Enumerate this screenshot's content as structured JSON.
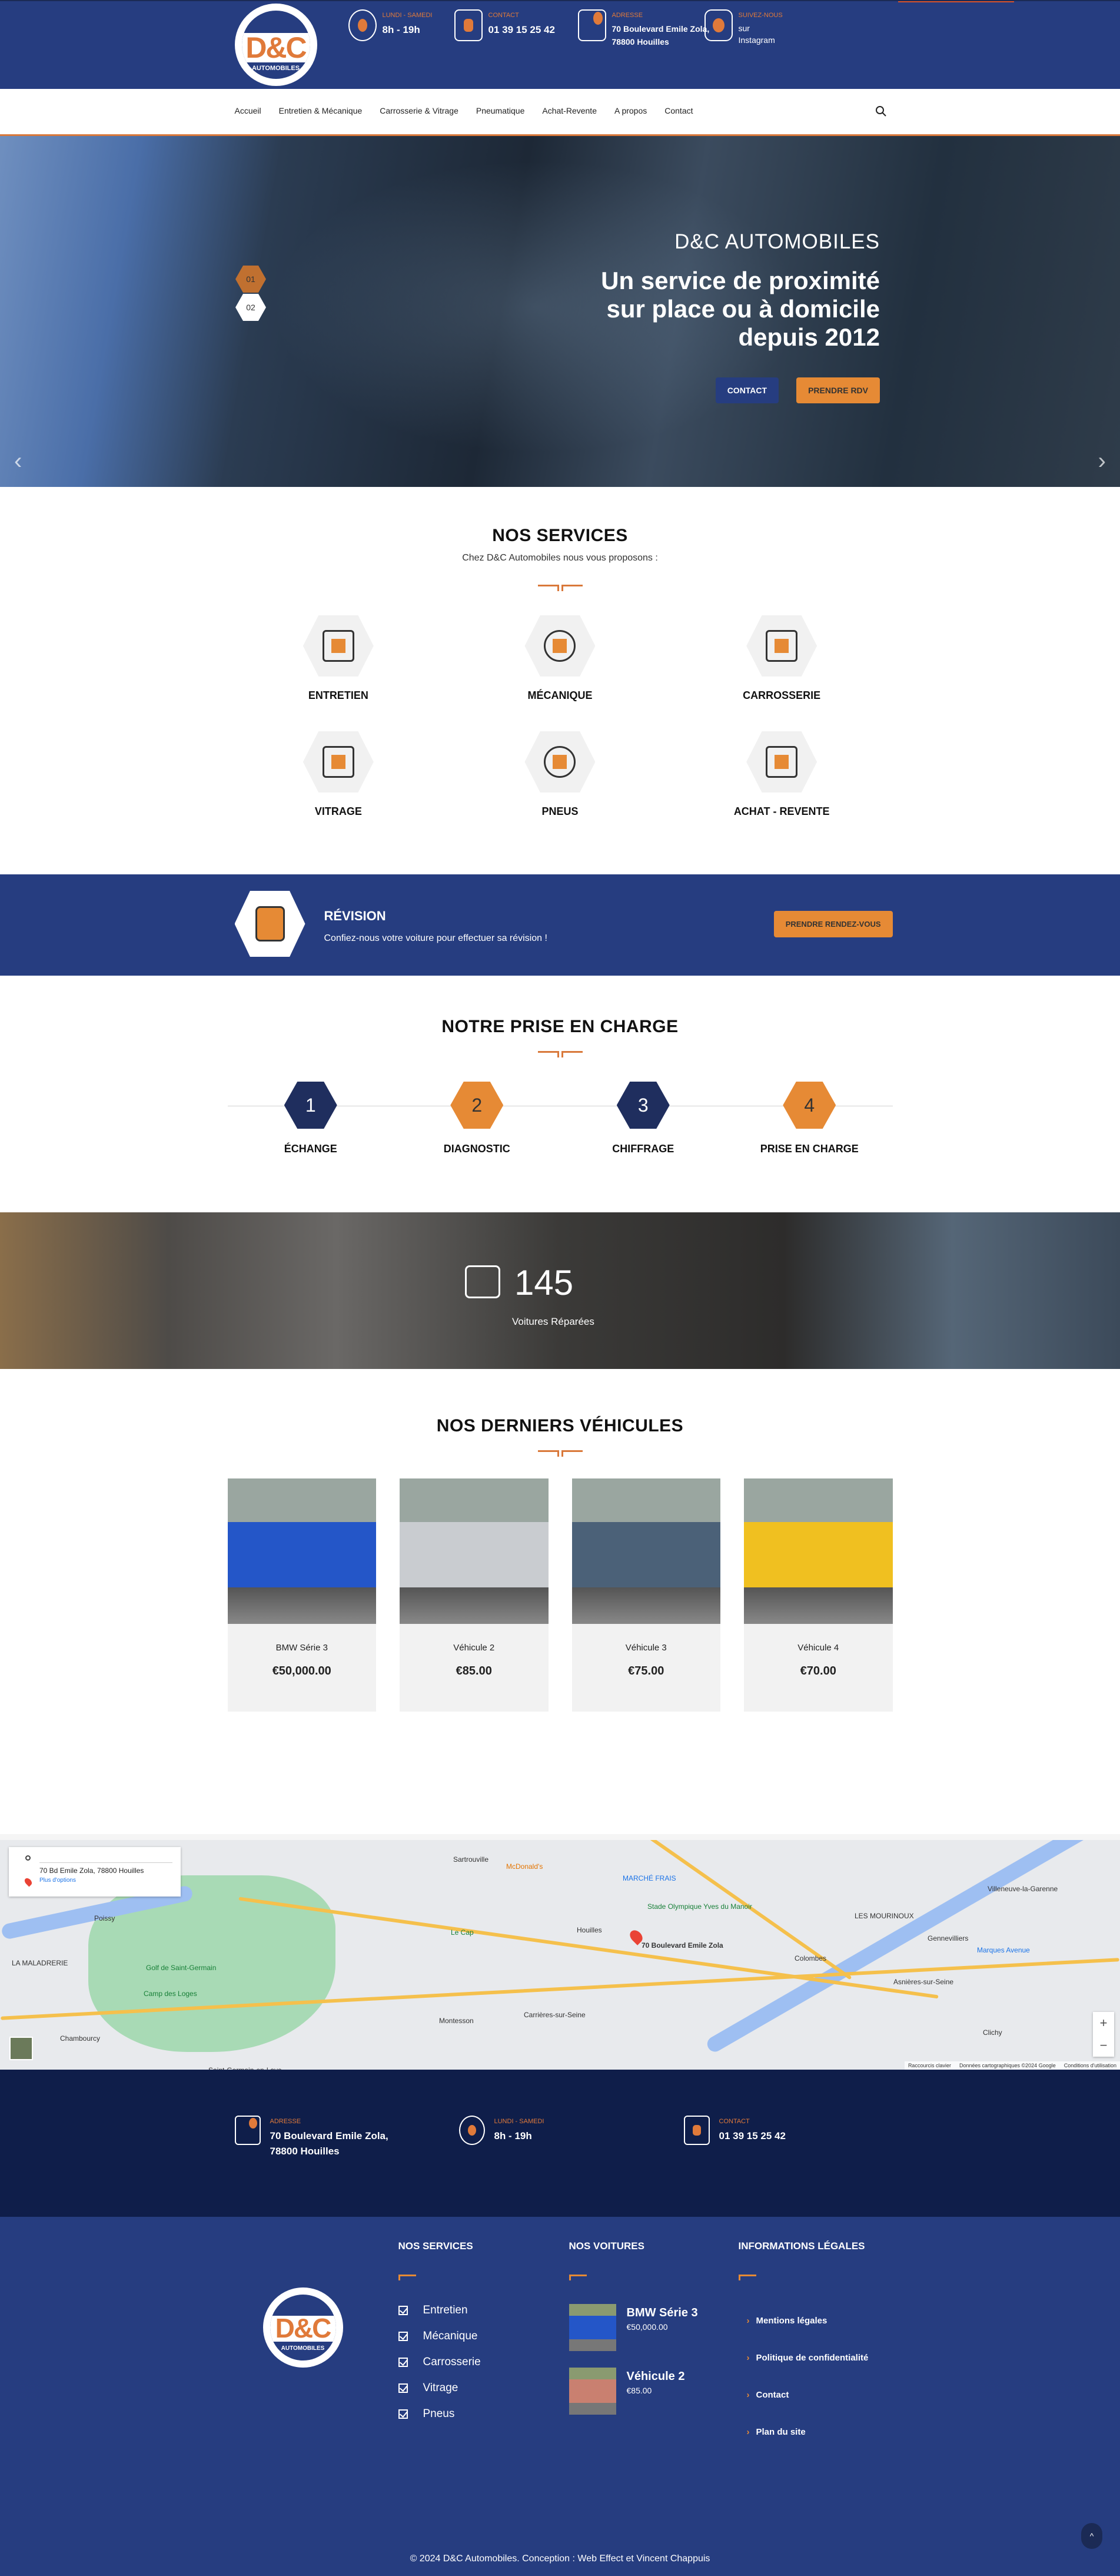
{
  "brand": {
    "logo_main": "D&C",
    "logo_sub": "AUTOMOBILES"
  },
  "topbar": {
    "hours": {
      "label": "LUNDI - SAMEDI",
      "value": "8h - 19h"
    },
    "contact": {
      "label": "CONTACT",
      "value": "01 39 15 25 42"
    },
    "address": {
      "label": "ADRESSE",
      "line1": "70 Boulevard Emile Zola,",
      "line2": "78800 Houilles"
    },
    "social": {
      "label": "SUIVEZ-NOUS",
      "line1": "sur",
      "line2": "Instagram"
    }
  },
  "nav": {
    "items": [
      "Accueil",
      "Entretien & Mécanique",
      "Carrosserie & Vitrage",
      "Pneumatique",
      "Achat-Revente",
      "A propos",
      "Contact"
    ],
    "search_icon": "search-icon"
  },
  "hero": {
    "brand": "D&C AUTOMOBILES",
    "headline_1": "Un service de proximité",
    "headline_2": "sur place ou à domicile",
    "headline_3": "depuis 2012",
    "contact_btn": "CONTACT",
    "rdv_btn": "PRENDRE RDV",
    "slides": [
      "01",
      "02"
    ],
    "active_slide": "01",
    "prev_icon": "‹",
    "next_icon": "›"
  },
  "services": {
    "title": "NOS SERVICES",
    "subtitle": "Chez D&C Automobiles nous vous proposons :",
    "items": [
      {
        "label": "ENTRETIEN",
        "icon": "mechanic-icon"
      },
      {
        "label": "MÉCANIQUE",
        "icon": "gear-icon"
      },
      {
        "label": "CARROSSERIE",
        "icon": "car-repair-icon"
      },
      {
        "label": "VITRAGE",
        "icon": "windshield-icon"
      },
      {
        "label": "PNEUS",
        "icon": "tires-icon"
      },
      {
        "label": "ACHAT - REVENTE",
        "icon": "computer-car-icon"
      }
    ]
  },
  "revision": {
    "title": "RÉVISION",
    "text": "Confiez-nous votre voiture pour effectuer sa révision !",
    "button": "PRENDRE RENDEZ-VOUS"
  },
  "process": {
    "title": "NOTRE PRISE EN CHARGE",
    "steps": [
      {
        "num": "1",
        "label": "ÉCHANGE"
      },
      {
        "num": "2",
        "label": "DIAGNOSTIC"
      },
      {
        "num": "3",
        "label": "CHIFFRAGE"
      },
      {
        "num": "4",
        "label": "PRISE EN CHARGE"
      }
    ]
  },
  "counter": {
    "value": "145",
    "label": "Voitures Réparées"
  },
  "vehicles": {
    "title": "NOS DERNIERS VÉHICULES",
    "items": [
      {
        "name": "BMW Série 3",
        "price": "€50,000.00",
        "color": "#2456c8"
      },
      {
        "name": "Véhicule 2",
        "price": "€85.00",
        "color": "#c9ccd0"
      },
      {
        "name": "Véhicule 3",
        "price": "€75.00",
        "color": "#4b6178"
      },
      {
        "name": "Véhicule 4",
        "price": "€70.00",
        "color": "#f0c020"
      }
    ]
  },
  "map": {
    "card_address": "70 Bd Emile Zola, 78800 Houilles",
    "card_more": "Plus d'options",
    "marker_label": "70 Boulevard Emile Zola",
    "places": [
      "Poissy",
      "Sartrouville",
      "Houilles",
      "Le Cap",
      "McDonald's",
      "Chambourcy",
      "Saint-Germain-en-Laye",
      "Golf de Saint-Germain",
      "Camp des Loges",
      "LA MALADRERIE",
      "Colombes",
      "Gennevilliers",
      "Villeneuve-la-Garenne",
      "Asnières-sur-Seine",
      "Clichy",
      "Montesson",
      "Carrières-sur-Seine",
      "MARCHÉ FRAIS",
      "Stade Olympique Yves du Manoir",
      "LES MOURINOUX",
      "Marques Avenue"
    ],
    "attribution": [
      "Raccourcis clavier",
      "Données cartographiques ©2024 Google",
      "Conditions d'utilisation"
    ],
    "zoom_in": "+",
    "zoom_out": "−"
  },
  "infobar": {
    "address": {
      "label": "ADRESSE",
      "line1": "70 Boulevard Emile Zola,",
      "line2": "78800 Houilles"
    },
    "hours": {
      "label": "LUNDI - SAMEDI",
      "value": "8h - 19h"
    },
    "contact": {
      "label": "CONTACT",
      "value": "01 39 15 25 42"
    }
  },
  "footer": {
    "services_title": "NOS SERVICES",
    "services": [
      "Entretien",
      "Mécanique",
      "Carrosserie",
      "Vitrage",
      "Pneus"
    ],
    "cars_title": "NOS VOITURES",
    "cars": [
      {
        "name": "BMW Série 3",
        "price": "€50,000.00",
        "color": "#2456c8"
      },
      {
        "name": "Véhicule 2",
        "price": "€85.00",
        "color": "#c98070"
      }
    ],
    "legal_title": "INFORMATIONS LÉGALES",
    "legal": [
      "Mentions légales",
      "Politique de confidentialité",
      "Contact",
      "Plan du site"
    ],
    "copyright": "© 2024 D&C Automobiles. Conception : Web Effect et Vincent Chappuis",
    "to_top": "^"
  },
  "colors": {
    "navy": "#263d80",
    "dark_navy": "#0f1e4a",
    "orange": "#e68a35"
  }
}
